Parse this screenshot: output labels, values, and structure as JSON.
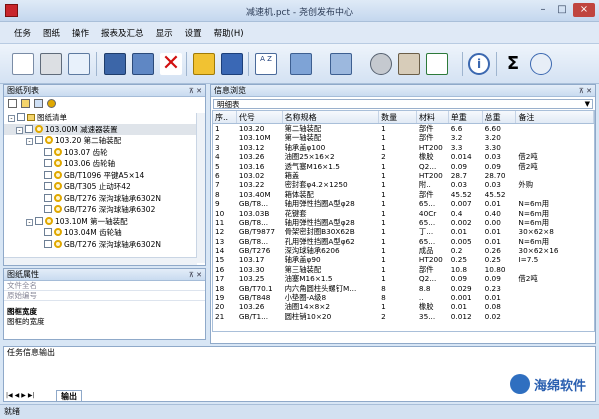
{
  "window": {
    "title": "减速机.pct - 尧创发布中心"
  },
  "menu": [
    "任务",
    "图纸",
    "操作",
    "报表及汇总",
    "显示",
    "设置",
    "帮助(H)"
  ],
  "toolbar": {
    "sigma": "Σ"
  },
  "left_panel": {
    "title": "图纸列表",
    "properties_title": "图纸属性",
    "field_file_name": "文件全名",
    "field_source_name": "原始编号",
    "info_title": "图框宽度",
    "info_desc": "图框的宽度"
  },
  "tree": [
    {
      "indent": 0,
      "box": "-",
      "text": "图纸清单",
      "icon": "folder"
    },
    {
      "indent": 1,
      "box": "-",
      "text": "103.00M 减速器装置",
      "icon": "gear"
    },
    {
      "indent": 2,
      "box": "-",
      "text": "103.20 第二轴装配",
      "icon": "gear"
    },
    {
      "indent": 3,
      "box": "",
      "text": "103.07 齿轮",
      "icon": "gear"
    },
    {
      "indent": 3,
      "box": "",
      "text": "103.06 齿轮轴",
      "icon": "gear"
    },
    {
      "indent": 3,
      "box": "",
      "text": "GB/T1096 平键A5×14",
      "icon": "gear"
    },
    {
      "indent": 3,
      "box": "",
      "text": "GB/T305 止动环42",
      "icon": "gear"
    },
    {
      "indent": 3,
      "box": "",
      "text": "GB/T276 深沟球轴承6302N",
      "icon": "gear"
    },
    {
      "indent": 3,
      "box": "",
      "text": "GB/T276 深沟球轴承6302",
      "icon": "gear"
    },
    {
      "indent": 2,
      "box": "-",
      "text": "103.10M 第一轴装配",
      "icon": "gear"
    },
    {
      "indent": 3,
      "box": "",
      "text": "103.04M 齿轮轴",
      "icon": "gear"
    },
    {
      "indent": 3,
      "box": "",
      "text": "GB/T276 深沟球轴承6302N",
      "icon": "gear"
    }
  ],
  "right_panel": {
    "title": "信息浏览",
    "dropdown": "明细表"
  },
  "table": {
    "headers": [
      "序..",
      "代号",
      "名称规格",
      "数量",
      "材料",
      "单重",
      "总重",
      "备注"
    ],
    "rows": [
      [
        "1",
        "103.20",
        "第二轴装配",
        "1",
        "部件",
        "6.6",
        "6.60",
        ""
      ],
      [
        "2",
        "103.10M",
        "第一轴装配",
        "1",
        "部件",
        "3.2",
        "3.20",
        ""
      ],
      [
        "3",
        "103.12",
        "轴承盖φ100",
        "1",
        "HT200",
        "3.3",
        "3.30",
        "",
        ""
      ],
      [
        "4",
        "103.26",
        "油圈25×16×2",
        "2",
        "橡胶",
        "0.014",
        "0.03",
        "借2吨"
      ],
      [
        "5",
        "103.16",
        "透气塞M16×1.5",
        "1",
        "Q2...",
        "0.09",
        "0.09",
        "借2吨"
      ],
      [
        "6",
        "103.02",
        "箱盖",
        "1",
        "HT200",
        "28.7",
        "28.70",
        ""
      ],
      [
        "7",
        "103.22",
        "密封套φ4.2×1250",
        "1",
        "附..",
        "0.03",
        "0.03",
        "外购"
      ],
      [
        "8",
        "103.40M",
        "箱体装配",
        "1",
        "部件",
        "45.52",
        "45.52",
        ""
      ],
      [
        "9",
        "GB/T8...",
        "轴用弹性挡圈A型φ28",
        "1",
        "65...",
        "0.007",
        "0.01",
        "N=6m用"
      ],
      [
        "10",
        "103.03B",
        "花键套",
        "1",
        "40Cr",
        "0.4",
        "0.40",
        "N=6m用"
      ],
      [
        "11",
        "GB/T8...",
        "轴用弹性挡圈A型φ28",
        "1",
        "65...",
        "0.002",
        "0.00",
        "N=6m用"
      ],
      [
        "12",
        "GB/T9877",
        "骨架密封圈B30X62B",
        "1",
        "丁...",
        "0.01",
        "0.01",
        "30×62×8"
      ],
      [
        "13",
        "GB/T8...",
        "孔用弹性挡圈A型φ62",
        "1",
        "65...",
        "0.005",
        "0.01",
        "N=6m用"
      ],
      [
        "14",
        "GB/T276",
        "深沟球轴承6206",
        "1",
        "成品",
        "0.2",
        "0.26",
        "30×62×16"
      ],
      [
        "15",
        "103.17",
        "轴承盖φ90",
        "1",
        "HT200",
        "0.25",
        "0.25",
        "I=7.5"
      ],
      [
        "16",
        "103.30",
        "第三轴装配",
        "1",
        "部件",
        "10.8",
        "10.80",
        ""
      ],
      [
        "17",
        "103.25",
        "油塞M16×1.5",
        "1",
        "Q2...",
        "0.09",
        "0.09",
        "借2吨"
      ],
      [
        "18",
        "GB/T70.1",
        "内六角圆柱头螺钉M...",
        "8",
        "8.8",
        "0.029",
        "0.23",
        ""
      ],
      [
        "19",
        "GB/T848",
        "小垫圈-A级8",
        "8",
        "..",
        "0.001",
        "0.01",
        ""
      ],
      [
        "20",
        "103.26",
        "油圈14×8×2",
        "1",
        "橡胶",
        "0.01",
        "0.08",
        ""
      ],
      [
        "21",
        "GB/T1...",
        "圆柱销10×20",
        "2",
        "35...",
        "0.012",
        "0.02",
        ""
      ]
    ]
  },
  "bottom": {
    "task_output": "任务信息输出",
    "tab_output": "输出",
    "status": "就绪"
  },
  "watermark": "海绵软件"
}
